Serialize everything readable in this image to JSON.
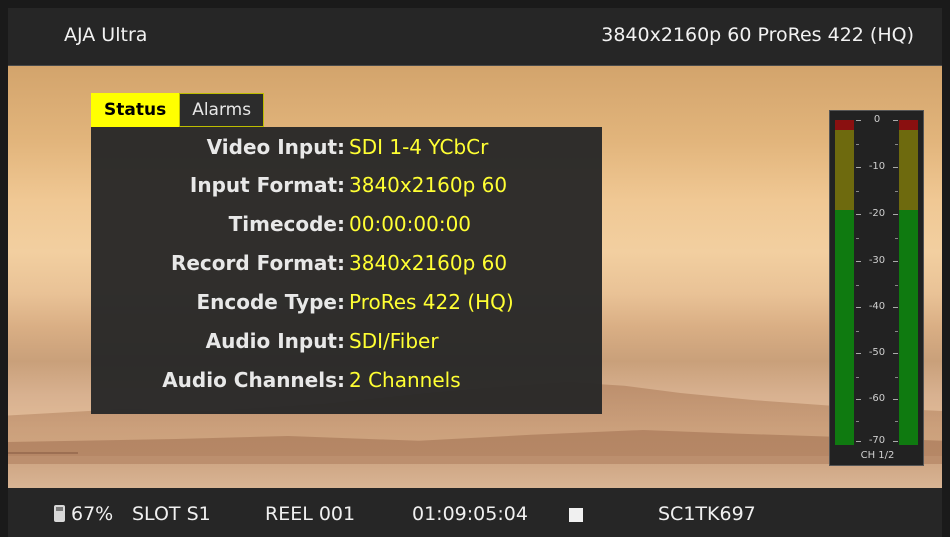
{
  "topbar": {
    "device": "AJA Ultra",
    "format": "3840x2160p 60 ProRes 422 (HQ)"
  },
  "tabs": [
    {
      "label": "Status",
      "active": true
    },
    {
      "label": "Alarms",
      "active": false
    }
  ],
  "status_rows": [
    {
      "label": "Video Input:",
      "value": "SDI 1-4 YCbCr"
    },
    {
      "label": "Input Format:",
      "value": "3840x2160p 60"
    },
    {
      "label": "Timecode:",
      "value": "00:00:00:00"
    },
    {
      "label": "Record Format:",
      "value": "3840x2160p 60"
    },
    {
      "label": "Encode Type:",
      "value": "ProRes 422 (HQ)"
    },
    {
      "label": "Audio Input:",
      "value": "SDI/Fiber"
    },
    {
      "label": "Audio Channels:",
      "value": "2 Channels"
    }
  ],
  "meter": {
    "scale": [
      "0",
      "-10",
      "-20",
      "-30",
      "-40",
      "-50",
      "-60",
      "-70"
    ],
    "channel_label": "CH 1/2",
    "colors": {
      "peak": "#8a1010",
      "warn": "#6e6a0e",
      "ok": "#0f7a10"
    }
  },
  "bottombar": {
    "media_icon": "media-card-icon",
    "media_percent": "67%",
    "slot": "SLOT S1",
    "reel": "REEL 001",
    "timecode": "01:09:05:04",
    "transport_icon": "stop-icon",
    "clip_name": "SC1TK697"
  },
  "colors": {
    "accent": "#ffff00",
    "value_text": "#ffff33",
    "bar_bg": "#262626"
  }
}
